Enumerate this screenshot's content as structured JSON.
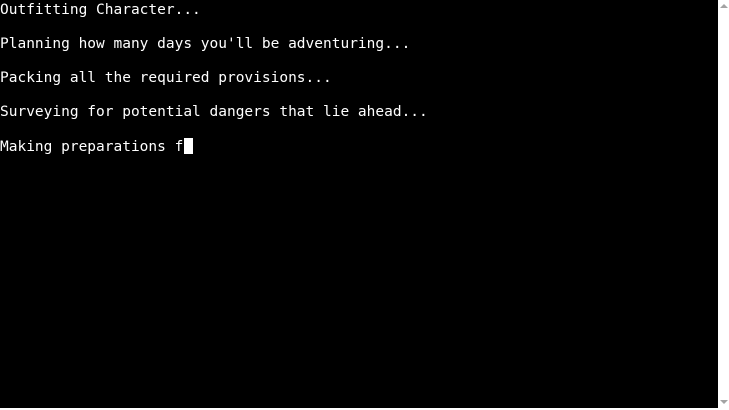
{
  "terminal": {
    "lines": [
      "Outfitting Character...",
      "Planning how many days you'll be adventuring...",
      "Packing all the required provisions...",
      "Surveying for potential dangers that lie ahead...",
      "Making preparations f"
    ]
  },
  "colors": {
    "background": "#000000",
    "text": "#ffffff",
    "scrollbar_arrow": "#a3a3a3"
  }
}
